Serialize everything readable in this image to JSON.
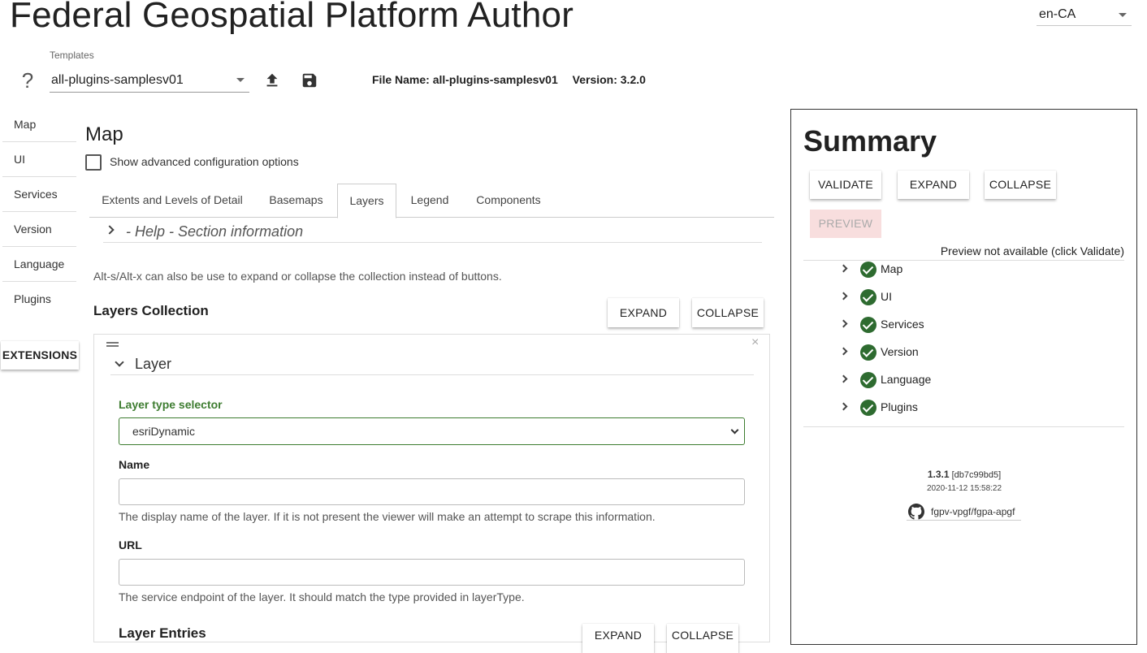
{
  "header": {
    "title": "Federal Geospatial Platform Author",
    "language": "en-CA",
    "templates_label": "Templates",
    "template_value": "all-plugins-samplesv01",
    "help_icon": "?",
    "file_name": "File Name: all-plugins-samplesv01",
    "version": "Version: 3.2.0"
  },
  "sidebar": {
    "items": [
      {
        "label": "Map"
      },
      {
        "label": "UI"
      },
      {
        "label": "Services"
      },
      {
        "label": "Version"
      },
      {
        "label": "Language"
      },
      {
        "label": "Plugins"
      }
    ],
    "extensions_label": "EXTENSIONS"
  },
  "main": {
    "title": "Map",
    "advanced_label": "Show advanced configuration options",
    "advanced_checked": false,
    "tabs": [
      {
        "label": "Extents and Levels of Detail"
      },
      {
        "label": "Basemaps"
      },
      {
        "label": "Layers"
      },
      {
        "label": "Legend"
      },
      {
        "label": "Components"
      }
    ],
    "active_tab": "Layers",
    "help_section": "- Help - Section information",
    "alt_hint": "Alt-s/Alt-x can also be use to expand or collapse the collection instead of buttons.",
    "layers_collection_title": "Layers Collection",
    "expand_label": "EXPAND",
    "collapse_label": "COLLAPSE",
    "close_symbol": "×",
    "layer": {
      "header": "Layer",
      "type_label": "Layer type selector",
      "type_value": "esriDynamic",
      "name_label": "Name",
      "name_value": "",
      "name_help": "The display name of the layer. If it is not present the viewer will make an attempt to scrape this information.",
      "url_label": "URL",
      "url_value": "",
      "url_help": "The service endpoint of the layer. It should match the type provided in layerType.",
      "entries_title": "Layer Entries",
      "entries_expand": "EXPAND",
      "entries_collapse": "COLLAPSE"
    }
  },
  "summary": {
    "title": "Summary",
    "validate_label": "VALIDATE",
    "expand_label": "EXPAND",
    "collapse_label": "COLLAPSE",
    "preview_label": "PREVIEW",
    "preview_note": "Preview not available (click Validate)",
    "items": [
      {
        "label": "Map"
      },
      {
        "label": "UI"
      },
      {
        "label": "Services"
      },
      {
        "label": "Version"
      },
      {
        "label": "Language"
      },
      {
        "label": "Plugins"
      }
    ],
    "version": "1.3.1",
    "commit": "[db7c99bd5]",
    "build_date": "2020-11-12 15:58:22",
    "repo": "fgpv-vpgf/fgpa-apgf"
  },
  "colors": {
    "valid_green": "#2e6b30",
    "accent_green": "#3e7d31",
    "preview_disabled_bg": "#f8dede"
  },
  "icons": {
    "upload": "upload-icon",
    "save": "save-icon",
    "github": "github-icon",
    "check": "check-circle-icon"
  }
}
